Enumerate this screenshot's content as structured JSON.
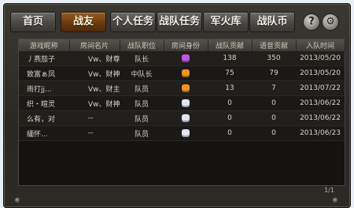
{
  "tabs": [
    {
      "label": "首页",
      "active": false
    },
    {
      "label": "战友",
      "active": true
    },
    {
      "label": "个人任务",
      "active": false
    },
    {
      "label": "战队任务",
      "active": false
    },
    {
      "label": "军火库",
      "active": false
    },
    {
      "label": "战队币",
      "active": false
    }
  ],
  "help_label": "?",
  "table": {
    "headers": [
      "游戏昵称",
      "房间名片",
      "战队职位",
      "房间身份",
      "战队贡献",
      "语音贡献",
      "入队时间"
    ],
    "rows": [
      {
        "nickname": "丿燕茄子",
        "card": "Vw、财尊",
        "position": "队长",
        "identity_color": "#c055e0",
        "team_contrib": "138",
        "voice_contrib": "350",
        "join_date": "2013/05/20"
      },
      {
        "nickname": "致富ぁ凤",
        "card": "Vw、财神",
        "position": "中队长",
        "identity_color": "#f0902a",
        "team_contrib": "75",
        "voice_contrib": "79",
        "join_date": "2013/05/20"
      },
      {
        "nickname": "雨打jj...",
        "card": "Vw、财主",
        "position": "队员",
        "identity_color": "#f0902a",
        "team_contrib": "13",
        "voice_contrib": "7",
        "join_date": "2013/07/22"
      },
      {
        "nickname": "织・暄灵",
        "card": "Vw、财神",
        "position": "队员",
        "identity_color": "#dfe6f0",
        "team_contrib": "0",
        "voice_contrib": "0",
        "join_date": "2013/06/22"
      },
      {
        "nickname": "么有，对",
        "card": "--",
        "position": "队员",
        "identity_color": "#dfe6f0",
        "team_contrib": "0",
        "voice_contrib": "0",
        "join_date": "2013/06/22"
      },
      {
        "nickname": "緬怀...",
        "card": "--",
        "position": "队员",
        "identity_color": "#dfe6f0",
        "team_contrib": "0",
        "voice_contrib": "0",
        "join_date": "2013/06/23"
      }
    ]
  },
  "pager": "1/1"
}
